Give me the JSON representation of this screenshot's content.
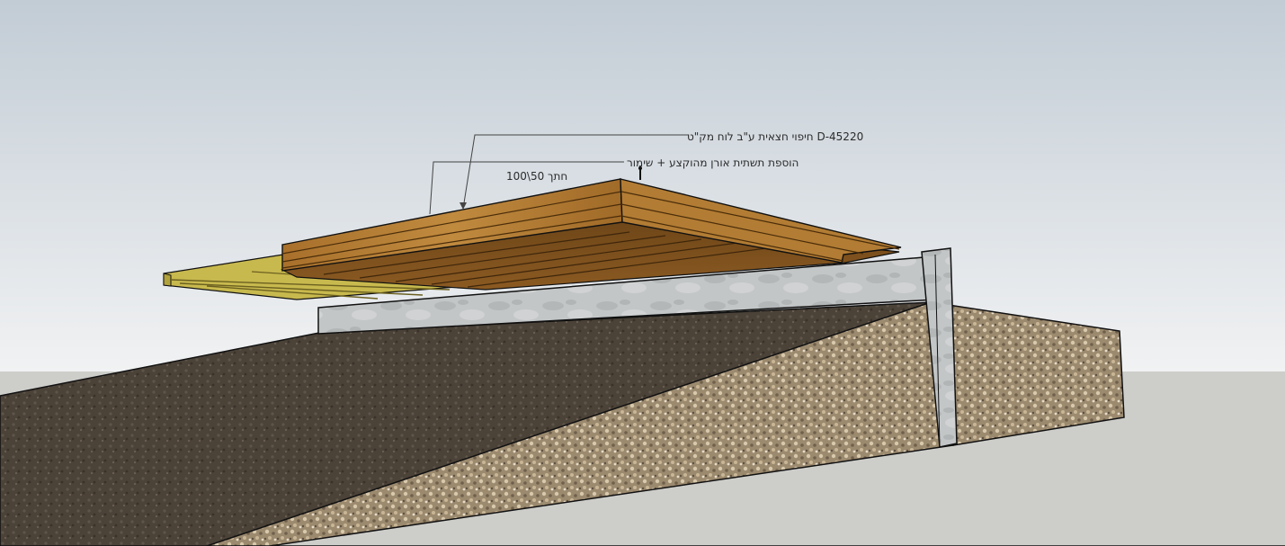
{
  "annotations": {
    "top_label": "D-45220 חיפוי חצאית ע\"ב לוח מק\"ט",
    "second_label_line1": "הוספת תשתית אורן מהוקצע + שימור",
    "second_label_line2": "חתך 50\\100"
  },
  "colors": {
    "sky_top": "#c3cdd6",
    "sky_bottom": "#eef0f1",
    "ground": "#cdcdca",
    "concrete": "#bfc2c3",
    "gravel": "#a7957a",
    "asphalt": "#4d443a",
    "wood_brown": "#b07a32",
    "wood_yellow": "#c9b64a"
  }
}
